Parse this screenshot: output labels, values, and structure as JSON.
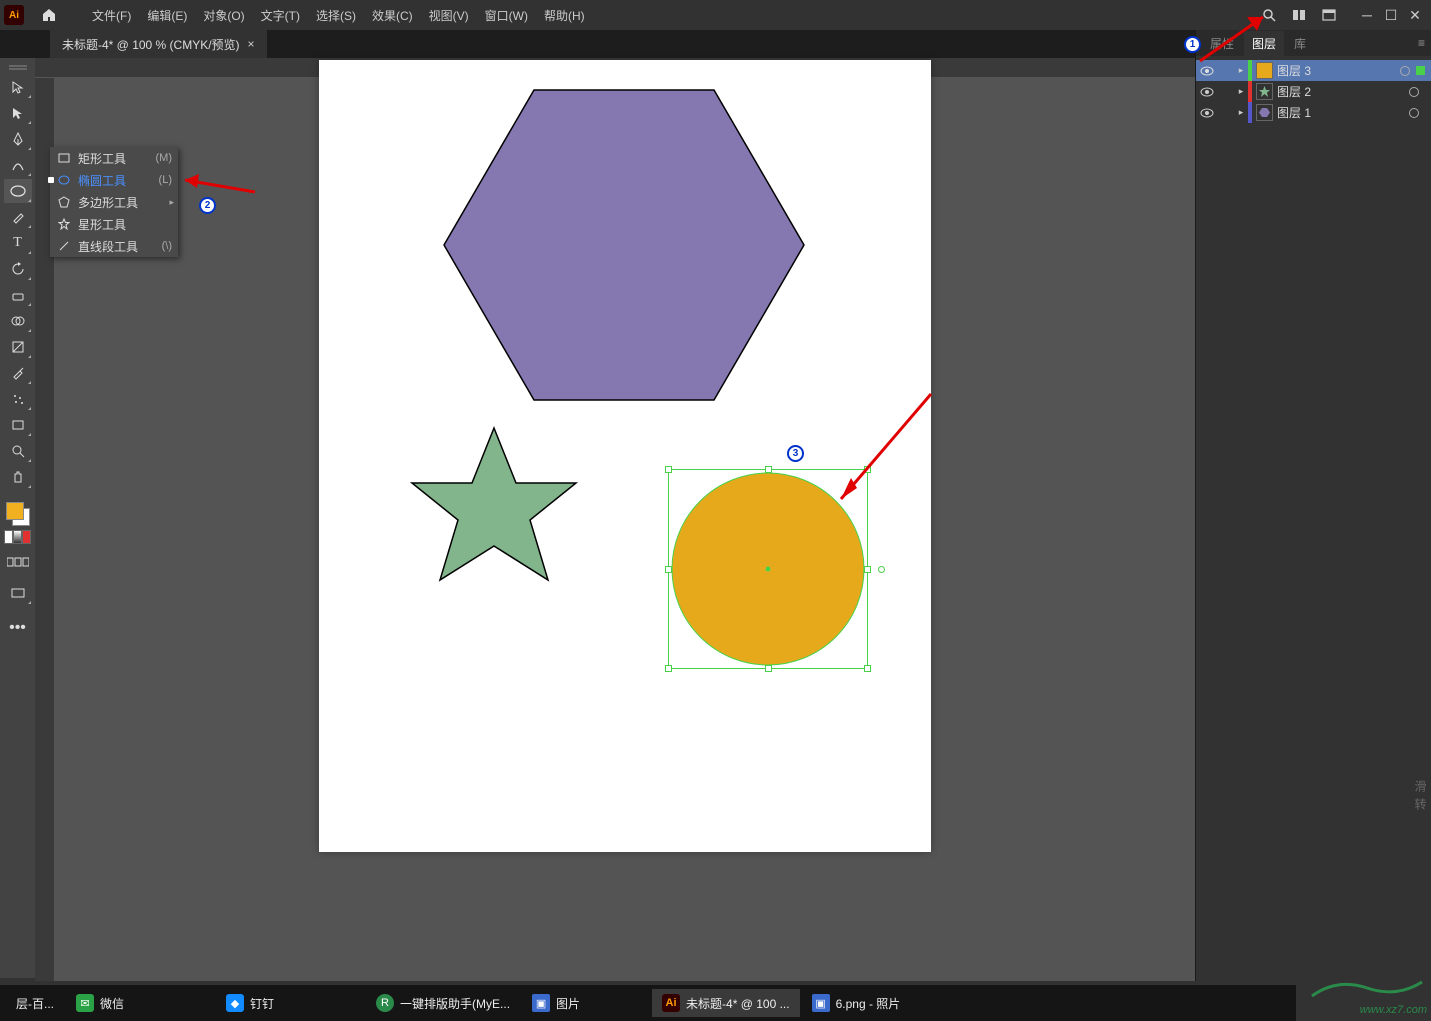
{
  "menubar": {
    "items": [
      "文件(F)",
      "编辑(E)",
      "对象(O)",
      "文字(T)",
      "选择(S)",
      "效果(C)",
      "视图(V)",
      "窗口(W)",
      "帮助(H)"
    ]
  },
  "doc_tab": {
    "title": "未标题-4* @ 100 % (CMYK/预览)"
  },
  "flyout": {
    "items": [
      {
        "label": "矩形工具",
        "shortcut": "(M)"
      },
      {
        "label": "椭圆工具",
        "shortcut": "(L)"
      },
      {
        "label": "多边形工具",
        "shortcut": ""
      },
      {
        "label": "星形工具",
        "shortcut": ""
      },
      {
        "label": "直线段工具",
        "shortcut": "(\\)"
      }
    ]
  },
  "panel": {
    "tabs": [
      "属性",
      "图层",
      "库"
    ],
    "layers": [
      {
        "name": "图层 3",
        "color": "#4ad14a",
        "thumb": "circle"
      },
      {
        "name": "图层 2",
        "color": "#e03030",
        "thumb": "star"
      },
      {
        "name": "图层 1",
        "color": "#5555cc",
        "thumb": "hex"
      }
    ]
  },
  "taskbar": {
    "items": [
      {
        "label": "层-百...",
        "icon": "",
        "color": ""
      },
      {
        "label": "微信",
        "icon": "wechat",
        "color": "#2ba245"
      },
      {
        "label": "钉钉",
        "icon": "ding",
        "color": "#118bff"
      },
      {
        "label": "一键排版助手(MyE...",
        "icon": "doc",
        "color": "#2a8a4a"
      },
      {
        "label": "图片",
        "icon": "img",
        "color": "#3a6acc"
      },
      {
        "label": "未标题-4* @ 100 ...",
        "icon": "ai",
        "color": "#ff9a00"
      },
      {
        "label": "6.png - 照片",
        "icon": "img",
        "color": "#3a6acc"
      }
    ]
  },
  "rhs_text": "滑转",
  "watermark": {
    "line1": "",
    "line2": "www.xz7.com"
  }
}
